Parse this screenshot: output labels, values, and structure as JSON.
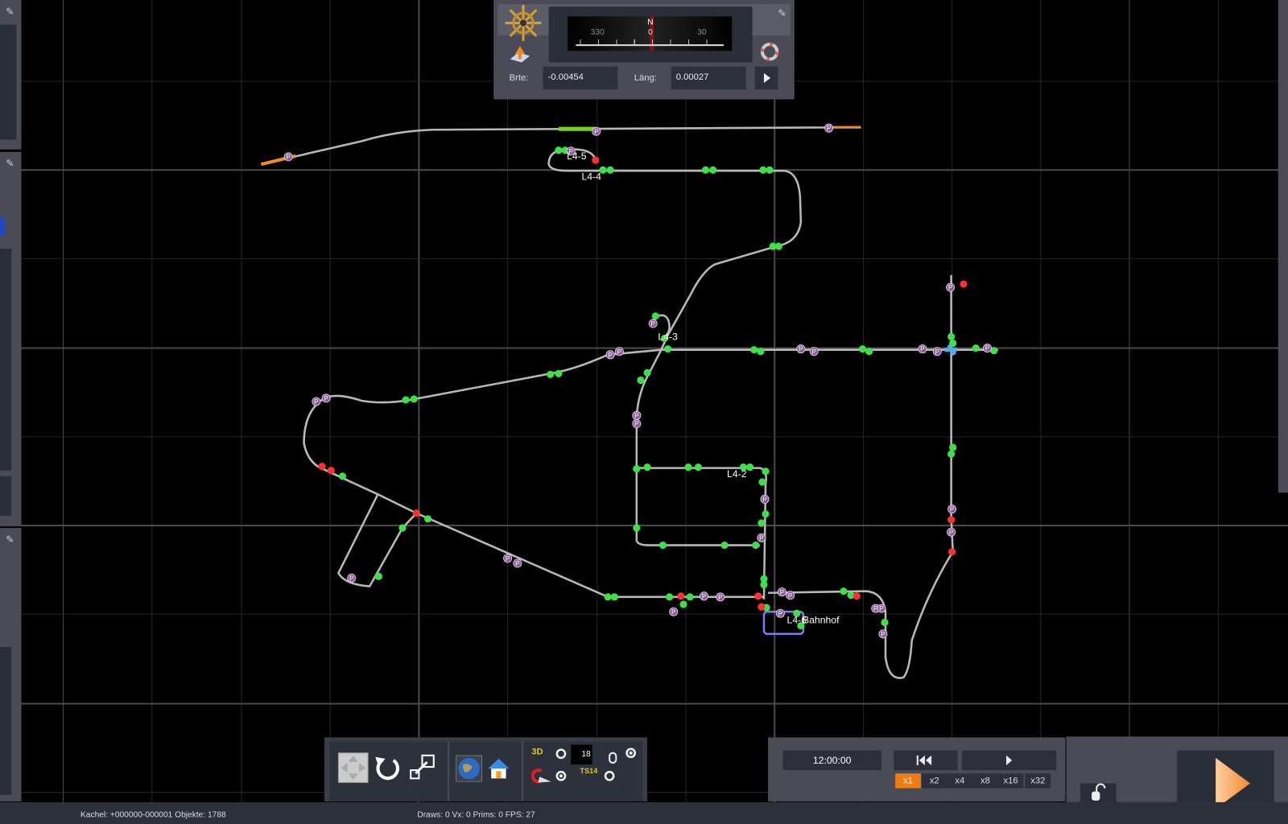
{
  "compass": {
    "north_label": "N",
    "ticks": [
      "330",
      "0",
      "30"
    ],
    "heading_deg": 0
  },
  "coords": {
    "lat_label": "Brte:",
    "lat_value": "-0.00454",
    "lon_label": "Läng:",
    "lon_value": "0.00027"
  },
  "map": {
    "labels": [
      "L4-5",
      "L4-4",
      "L4-3",
      "L4-2",
      "L4-6",
      "Bahnhof"
    ],
    "marker_letter": "P",
    "colors": {
      "track": "#b8b8b8",
      "signal_green": "#3ee04a",
      "signal_red": "#ff3030",
      "marker": "#8e5a9e",
      "platform": "#5aa8e8",
      "grid": "#3a3a3a"
    }
  },
  "toolbar": {
    "layer_number": "18",
    "icons": [
      "fit-view",
      "rotate",
      "resize",
      "globe",
      "home",
      "3d-camera",
      "magnet",
      "ts14-axes",
      "mouse-lock"
    ]
  },
  "clock": {
    "time": "12:00:00",
    "speeds": [
      "x1",
      "x2",
      "x4",
      "x8",
      "x16",
      "x32"
    ],
    "active_speed": "x1"
  },
  "status": {
    "left": "Kachel: +000000-000001  Objekte: 1788",
    "right": "Draws: 0 Vx: 0 Prims: 0 FPS: 27"
  },
  "accent": "#f07d12"
}
